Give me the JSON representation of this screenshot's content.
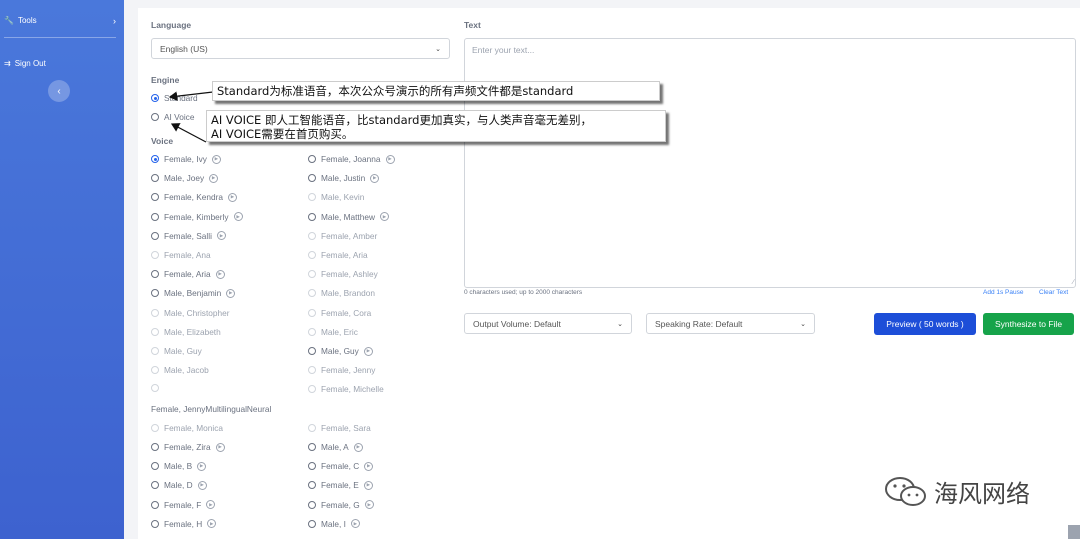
{
  "sidebar": {
    "tools_label": "Tools",
    "signout_label": "Sign Out"
  },
  "language": {
    "label": "Language",
    "value": "English (US)"
  },
  "engine": {
    "label": "Engine",
    "options": [
      "Standard",
      "AI Voice"
    ],
    "selected": "Standard"
  },
  "voice": {
    "label": "Voice",
    "left": [
      {
        "label": "Female, Ivy",
        "play": true,
        "checked": true,
        "disabled": false
      },
      {
        "label": "Male, Joey",
        "play": true,
        "checked": false,
        "disabled": false
      },
      {
        "label": "Female, Kendra",
        "play": true,
        "checked": false,
        "disabled": false
      },
      {
        "label": "Female, Kimberly",
        "play": true,
        "checked": false,
        "disabled": false
      },
      {
        "label": "Female, Salli",
        "play": true,
        "checked": false,
        "disabled": false
      },
      {
        "label": "Female, Ana",
        "play": false,
        "checked": false,
        "disabled": true
      },
      {
        "label": "Female, Aria",
        "play": true,
        "checked": false,
        "disabled": false
      },
      {
        "label": "Male, Benjamin",
        "play": true,
        "checked": false,
        "disabled": false
      },
      {
        "label": "Male, Christopher",
        "play": false,
        "checked": false,
        "disabled": true
      },
      {
        "label": "Male, Elizabeth",
        "play": false,
        "checked": false,
        "disabled": true
      },
      {
        "label": "Male, Guy",
        "play": false,
        "checked": false,
        "disabled": true
      },
      {
        "label": "Male, Jacob",
        "play": false,
        "checked": false,
        "disabled": true
      },
      {
        "label": "",
        "play": false,
        "checked": false,
        "disabled": true
      },
      null,
      {
        "label": "Female, Monica",
        "play": false,
        "checked": false,
        "disabled": true
      },
      {
        "label": "Female, Zira",
        "play": true,
        "checked": false,
        "disabled": false
      },
      {
        "label": "Male, B",
        "play": true,
        "checked": false,
        "disabled": false
      },
      {
        "label": "Male, D",
        "play": true,
        "checked": false,
        "disabled": false
      },
      {
        "label": "Female, F",
        "play": true,
        "checked": false,
        "disabled": false
      },
      {
        "label": "Female, H",
        "play": true,
        "checked": false,
        "disabled": false
      }
    ],
    "right": [
      {
        "label": "Female, Joanna",
        "play": true,
        "checked": false,
        "disabled": false
      },
      {
        "label": "Male, Justin",
        "play": true,
        "checked": false,
        "disabled": false
      },
      {
        "label": "Male, Kevin",
        "play": false,
        "checked": false,
        "disabled": true
      },
      {
        "label": "Male, Matthew",
        "play": true,
        "checked": false,
        "disabled": false
      },
      {
        "label": "Female, Amber",
        "play": false,
        "checked": false,
        "disabled": true
      },
      {
        "label": "Female, Aria",
        "play": false,
        "checked": false,
        "disabled": true
      },
      {
        "label": "Female, Ashley",
        "play": false,
        "checked": false,
        "disabled": true
      },
      {
        "label": "Male, Brandon",
        "play": false,
        "checked": false,
        "disabled": true
      },
      {
        "label": "Female, Cora",
        "play": false,
        "checked": false,
        "disabled": true
      },
      {
        "label": "Male, Eric",
        "play": false,
        "checked": false,
        "disabled": true
      },
      {
        "label": "Male, Guy",
        "play": true,
        "checked": false,
        "disabled": false
      },
      {
        "label": "Female, Jenny",
        "play": false,
        "checked": false,
        "disabled": true
      },
      {
        "label": "Female, Michelle",
        "play": false,
        "checked": false,
        "disabled": true
      },
      null,
      {
        "label": "Female, Sara",
        "play": false,
        "checked": false,
        "disabled": true
      },
      {
        "label": "Male, A",
        "play": true,
        "checked": false,
        "disabled": false
      },
      {
        "label": "Female, C",
        "play": true,
        "checked": false,
        "disabled": false
      },
      {
        "label": "Female, E",
        "play": true,
        "checked": false,
        "disabled": false
      },
      {
        "label": "Female, G",
        "play": true,
        "checked": false,
        "disabled": false
      },
      {
        "label": "Male, I",
        "play": true,
        "checked": false,
        "disabled": false
      }
    ],
    "wrapped_label": "Female, JennyMultilingualNeural"
  },
  "text": {
    "label": "Text",
    "placeholder": "Enter your text...",
    "counter": "0 characters used; up to 2000 characters",
    "add_pause": "Add 1s Pause",
    "clear_text": "Clear Text"
  },
  "controls": {
    "volume": "Output Volume: Default",
    "rate": "Speaking Rate: Default",
    "preview": "Preview ( 50 words )",
    "synthesize": "Synthesize to File"
  },
  "annotations": {
    "note1": "Standard为标准语音，本次公众号演示的所有声频文件都是standard",
    "note2_line1": "AI  VOICE  即人工智能语音，比standard更加真实，与人类声音毫无差别，",
    "note2_line2": "AI  VOICE需要在首页购买。"
  },
  "watermark": "海风网络",
  "colors": {
    "sidebar": "#4a78db",
    "preview_button": "#1d4ed8",
    "synthesize_button": "#16a34a",
    "radio_checked": "#2563eb"
  }
}
